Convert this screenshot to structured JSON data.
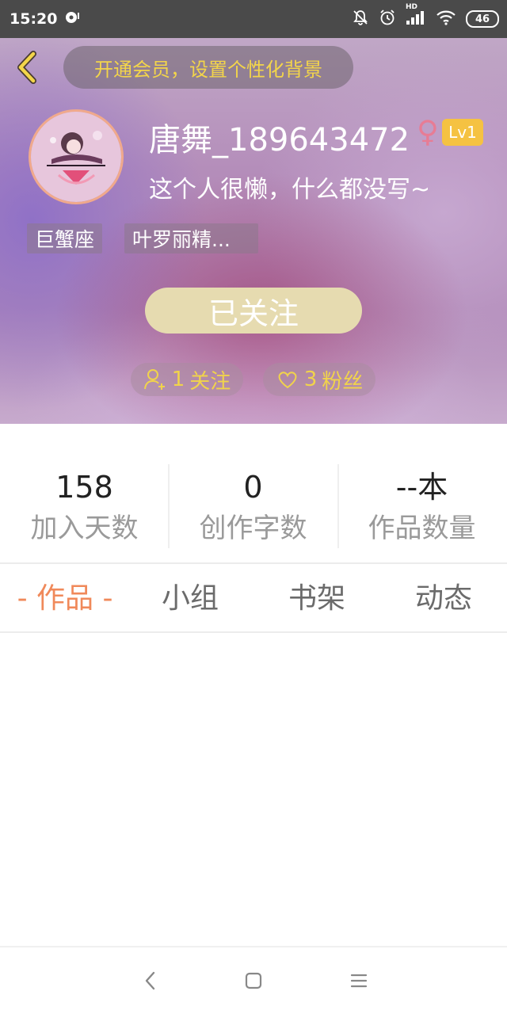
{
  "status_bar": {
    "time": "15:20",
    "network_badge": "HD",
    "battery": "46",
    "icons": [
      "media-icon",
      "mute-icon",
      "alarm-icon",
      "signal-icon",
      "wifi-icon",
      "battery-icon"
    ]
  },
  "header": {
    "vip_banner": "开通会员，设置个性化背景"
  },
  "profile": {
    "username": "唐舞_189643472",
    "gender_symbol": "♀",
    "level": "Lv1",
    "bio": "这个人很懒，什么都没写~",
    "tags": [
      "巨蟹座",
      "叶罗丽精..."
    ],
    "follow_button": "已关注",
    "following": {
      "count": "1",
      "label": "关注"
    },
    "followers": {
      "count": "3",
      "label": "粉丝"
    }
  },
  "stats": [
    {
      "value": "158",
      "label": "加入天数"
    },
    {
      "value": "0",
      "label": "创作字数"
    },
    {
      "value": "--本",
      "label": "作品数量"
    }
  ],
  "tabs": [
    {
      "label": "- 作品 -",
      "active": true
    },
    {
      "label": "小组",
      "active": false
    },
    {
      "label": "书架",
      "active": false
    },
    {
      "label": "动态",
      "active": false
    }
  ],
  "colors": {
    "accent_orange": "#f0895a",
    "vip_yellow": "#f3d54a",
    "level_badge": "#f5c242",
    "follow_button": "#e6dbb0",
    "gender_pink": "#e77c95"
  }
}
